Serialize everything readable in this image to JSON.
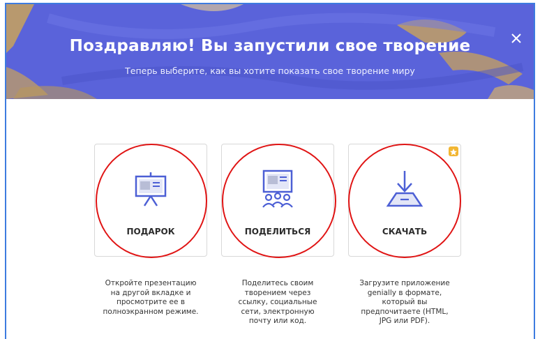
{
  "dialog": {
    "title": "Поздравляю! Вы запустили свое творение",
    "subtitle": "Теперь выберите, как вы хотите показать свое творение миру",
    "close_icon": "close-icon"
  },
  "options": [
    {
      "label": "ПОДАРОК",
      "icon": "presentation-board-icon",
      "description": "Откройте презентацию\nна другой вкладке и\nпросмотрите ее в\nполноэкранном режиме."
    },
    {
      "label": "ПОДЕЛИТЬСЯ",
      "icon": "share-people-icon",
      "description": "Поделитесь своим\nтворением через\nссылку, социальные\nсети, электронную\nпочту или код."
    },
    {
      "label": "СКАЧАТЬ",
      "icon": "download-icon",
      "description": "Загрузите приложение\ngenially в формате,\nкоторый вы\nпредпочитаете (HTML,\nJPG или PDF).",
      "badge": "premium-star-icon"
    }
  ],
  "colors": {
    "banner": "#5660d8",
    "gold": "#c9a25a",
    "accent": "#4c5fd5",
    "annotation": "#e01414",
    "premium": "#f2b632"
  }
}
